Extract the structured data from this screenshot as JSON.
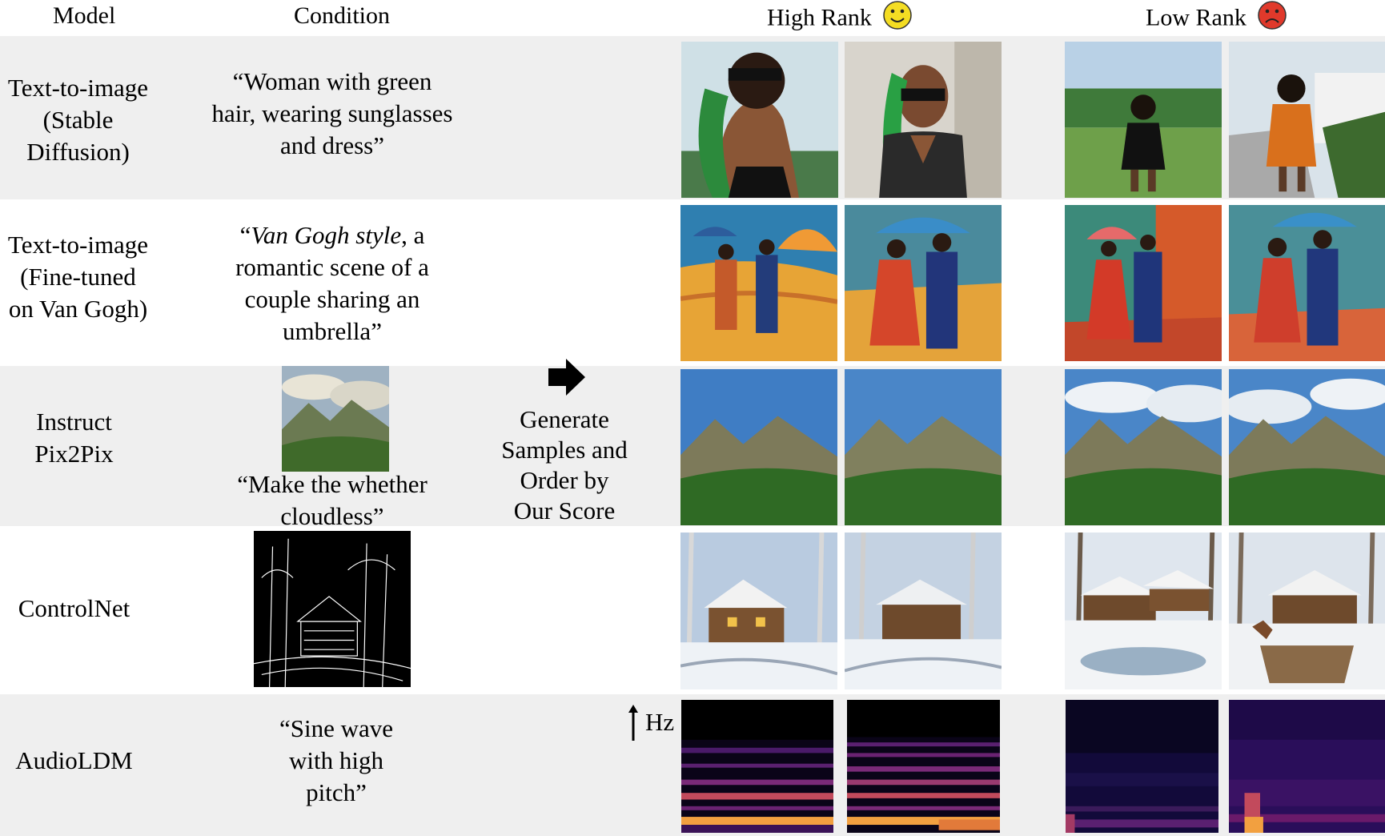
{
  "header": {
    "model": "Model",
    "condition": "Condition",
    "high_rank": "High Rank",
    "low_rank": "Low Rank",
    "high_icon": "smiley-face-icon",
    "low_icon": "frowning-face-icon"
  },
  "rows": [
    {
      "model_lines": [
        "Text-to-image",
        "(Stable",
        "Diffusion)"
      ],
      "condition_lines": [
        "“Woman with green",
        "hair, wearing sunglasses",
        "and dress”"
      ]
    },
    {
      "model_lines": [
        "Text-to-image",
        "(Fine-tuned",
        "on Van Gogh)"
      ],
      "condition_italic": "Van Gogh style",
      "condition_first_pre": "“",
      "condition_first_post": ", a",
      "condition_lines": [
        "romantic scene of a",
        "couple sharing an",
        "umbrella”"
      ]
    },
    {
      "model_lines": [
        "Instruct",
        "Pix2Pix"
      ],
      "condition_lines": [
        "“Make the whether",
        "cloudless”"
      ]
    },
    {
      "model_lines": [
        "ControlNet"
      ]
    },
    {
      "model_lines": [
        "AudioLDM"
      ],
      "condition_lines": [
        "“Sine wave",
        "with high",
        "pitch”"
      ]
    }
  ],
  "middle": {
    "generate_lines": [
      "Generate",
      "Samples and",
      "Order by",
      "Our Score"
    ],
    "arrow_icon": "right-arrow-icon",
    "hz_label": "Hz"
  },
  "colors": {
    "band_gray": "#efefef",
    "frown": "#e0392b",
    "smile": "#f4dd23"
  }
}
